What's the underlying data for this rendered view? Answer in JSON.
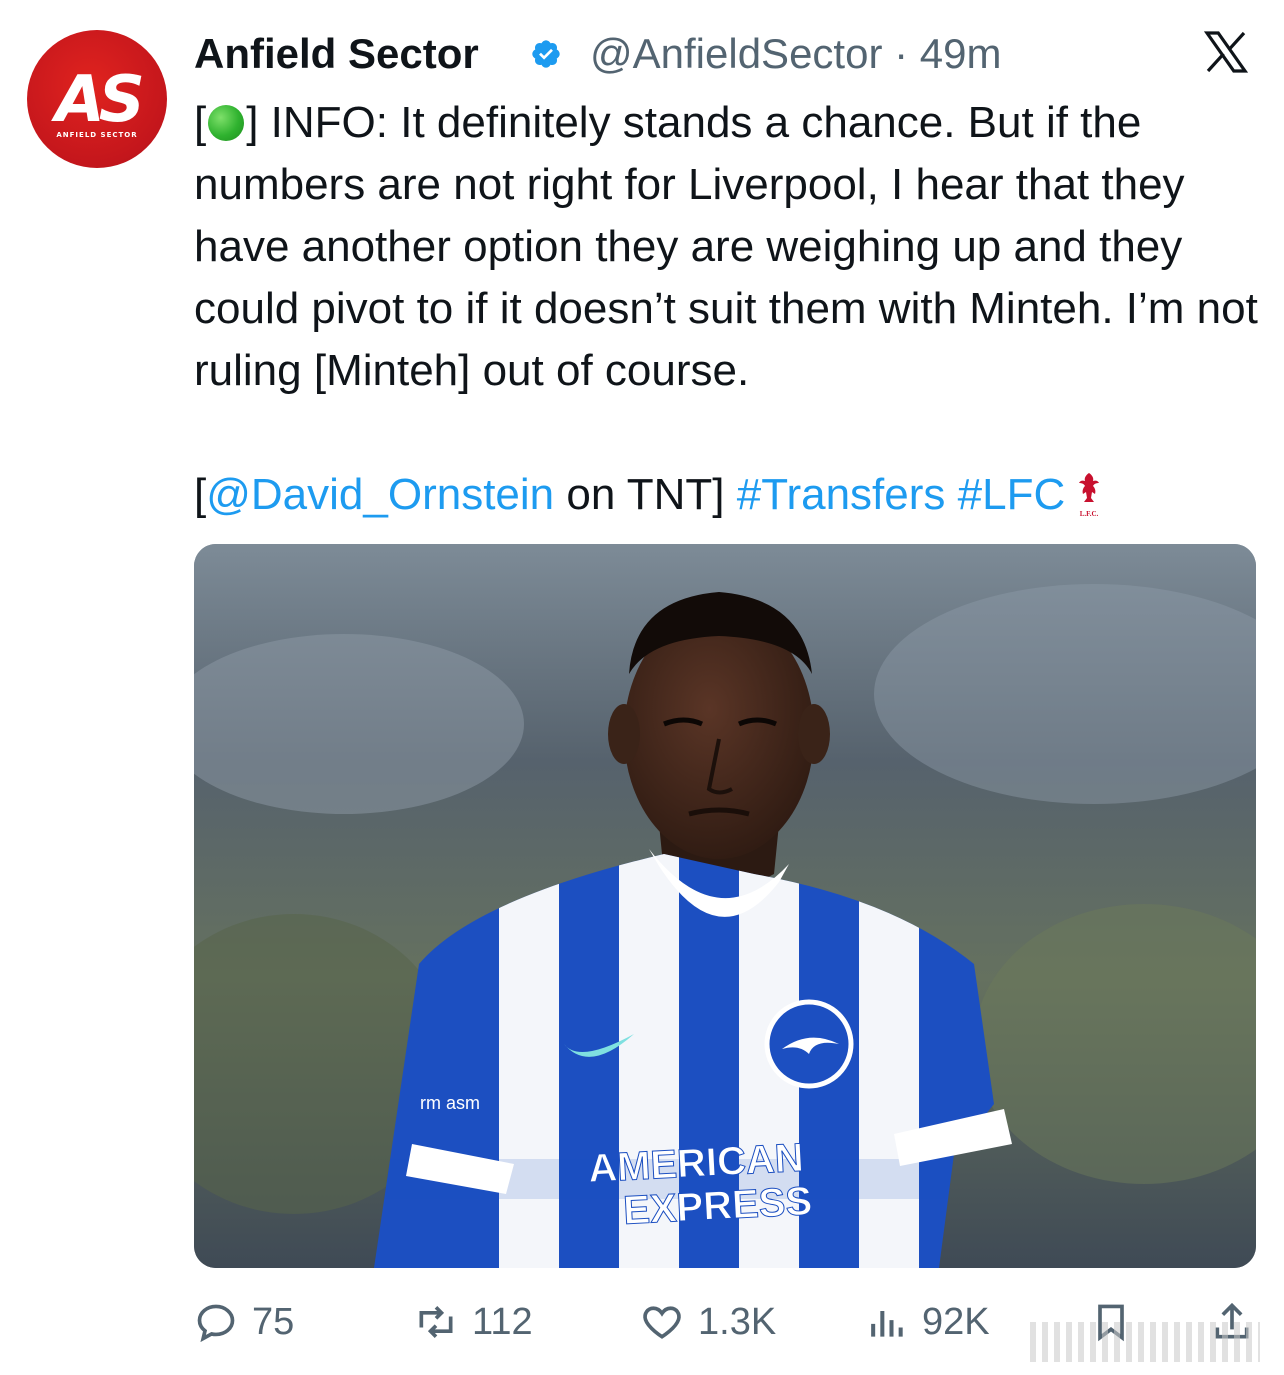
{
  "author": {
    "display_name": "Anfield Sector",
    "handle": "@AnfieldSector",
    "separator": "·",
    "time": "49m",
    "avatar_monogram": "AS",
    "avatar_subtext": "ANFIELD SECTOR",
    "verified_icon": "verified-badge-icon"
  },
  "tweet": {
    "line1_prefix": "[",
    "line1_after_dot": "] INFO: It definitely stands a chance. But if the numbers are not right for Liverpool, I hear that they have another option they are weighing up and they could pivot to if it doesn’t suit them with Minteh. I’m not ruling [Minteh] out of course.",
    "credit_open": "[",
    "mention": "@David_Ornstein",
    "credit_middle": " on TNT] ",
    "hashtag1": "#Transfers",
    "hashtag2": "#LFC",
    "lfc_icon": "liverbird-icon",
    "lfc_icon_text": "L.F.C."
  },
  "media": {
    "shirt_sponsor_line1": "AMERICAN",
    "shirt_sponsor_line2": "EXPRESS",
    "sleeve_text": "rm asm"
  },
  "actions": {
    "replies": "75",
    "reposts": "112",
    "likes": "1.3K",
    "views": "92K"
  },
  "colors": {
    "text": "#0f1419",
    "secondary": "#536471",
    "link": "#1d9bf0",
    "avatar_red": "#c4161c",
    "verified_blue": "#1d9bf0",
    "brighton_blue": "#1c4fc1"
  }
}
